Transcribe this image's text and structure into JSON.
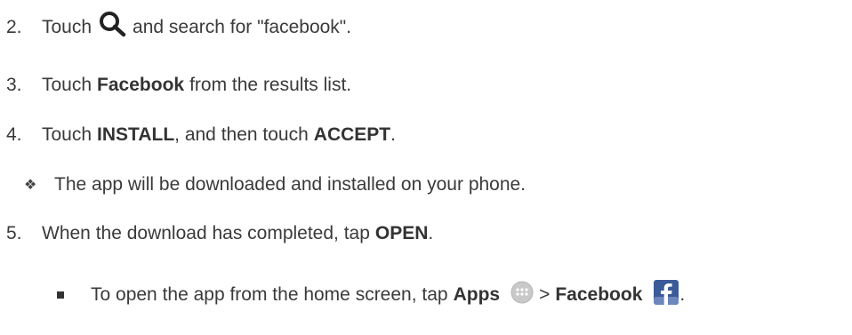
{
  "steps": [
    {
      "num": "2.",
      "pre": "Touch",
      "post": "and search for \"facebook\".",
      "icon": "search-icon"
    },
    {
      "num": "3.",
      "pre": "Touch",
      "bold": "Facebook",
      "post": "from the results list."
    },
    {
      "num": "4.",
      "pre": "Touch",
      "bold1": "INSTALL",
      "mid": ", and then touch",
      "bold2": "ACCEPT",
      "post": "."
    },
    {
      "num": "5.",
      "pre": "When the download has completed, tap",
      "bold": "OPEN",
      "post": "."
    }
  ],
  "note": {
    "bullet": "❖",
    "text": "The app will be downloaded and installed on your phone."
  },
  "sub": {
    "pre": "To open the app from the home screen, tap",
    "bold1": "Apps",
    "sep": ">",
    "bold2": "Facebook",
    "post": ".",
    "icons": [
      "apps-icon",
      "facebook-icon"
    ]
  }
}
